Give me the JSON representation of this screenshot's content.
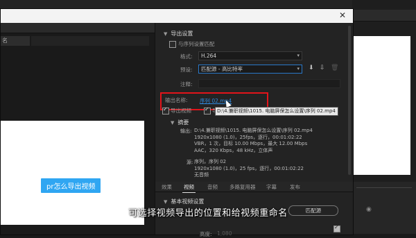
{
  "dialog": {
    "close_icon": "close-icon"
  },
  "left_pane": {
    "top_dropdown": "名",
    "preview_button": "pr怎么导出视频"
  },
  "export_settings": {
    "title": "导出设置",
    "match_sequence_label": "与序列设置匹配",
    "format_label": "格式:",
    "format_value": "H.264",
    "preset_label": "预设:",
    "preset_value": "匹配源 - 高比特率",
    "comments_label": "注释:",
    "output_name_label": "输出名称:",
    "output_name_value": "序列 02.mp4",
    "export_video_label": "导出视频",
    "export_audio_label": "导",
    "tooltip_path": "D:\\4.兼职视频\\1015. 电脑屏保怎么设置\\序列 02.mp4"
  },
  "summary": {
    "title": "摘要",
    "output_key": "输出:",
    "output_lines": [
      "D:\\4.兼职视频\\1015. 电脑屏保怎么设置\\序列 02.mp4",
      "1920x1080 (1.0)，25fps，逐行，00:01:02:22",
      "VBR，1 次，目标 10.00 Mbps，最大 12.00 Mbps",
      "AAC，320 Kbps，48  kHz，立体声"
    ],
    "source_key": "源:",
    "source_lines": [
      "序列，序列 02",
      "1920x1080 (1.0)，25 fps，逐行，00:01:02:22",
      "无音频"
    ]
  },
  "tabs": [
    "效果",
    "视频",
    "音频",
    "多路复用器",
    "字幕",
    "发布"
  ],
  "active_tab": "视频",
  "video_settings": {
    "title": "基本视频设置",
    "match_source_button": "匹配源",
    "height_label": "高度:",
    "height_value": "1,080"
  },
  "subtitle": "可选择视频导出的位置和给视频重命名",
  "colors": {
    "accent": "#2f8be0",
    "highlight_box": "#e3141a",
    "preview_button": "#2fa6f2"
  }
}
